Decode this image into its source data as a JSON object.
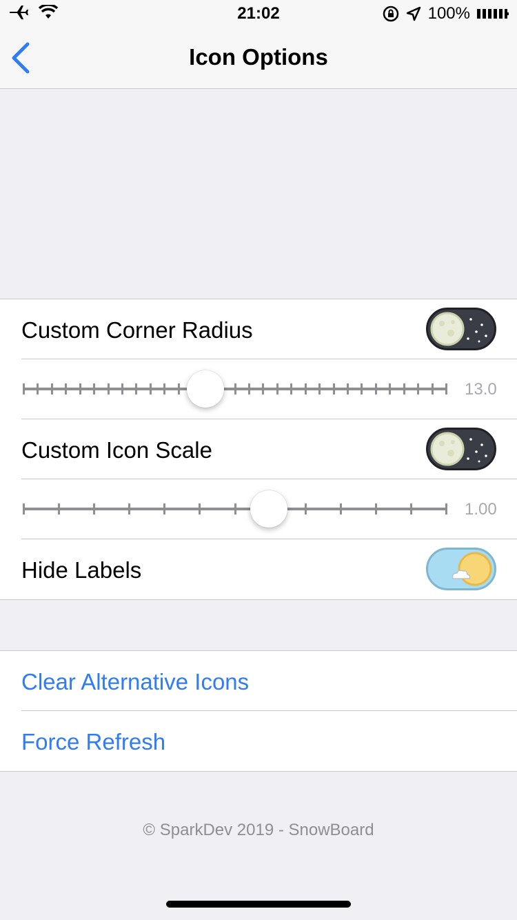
{
  "status_bar": {
    "time": "21:02",
    "battery": "100%",
    "icons": [
      "airplane-icon",
      "wifi-icon",
      "orientation-lock-icon",
      "location-icon",
      "battery-icon"
    ]
  },
  "nav": {
    "title": "Icon Options",
    "back_icon": "chevron-left-icon",
    "accent": "#2f7cf6"
  },
  "settings": {
    "corner_radius": {
      "label": "Custom Corner Radius",
      "enabled": true,
      "value_text": "13.0",
      "slider_fraction": 0.43
    },
    "icon_scale": {
      "label": "Custom Icon Scale",
      "enabled": true,
      "value_text": "1.00",
      "slider_fraction": 0.58
    },
    "hide_labels": {
      "label": "Hide Labels",
      "enabled": false
    }
  },
  "actions": {
    "clear_alternative_icons": "Clear Alternative Icons",
    "force_refresh": "Force Refresh"
  },
  "footer": "© SparkDev 2019 - SnowBoard"
}
